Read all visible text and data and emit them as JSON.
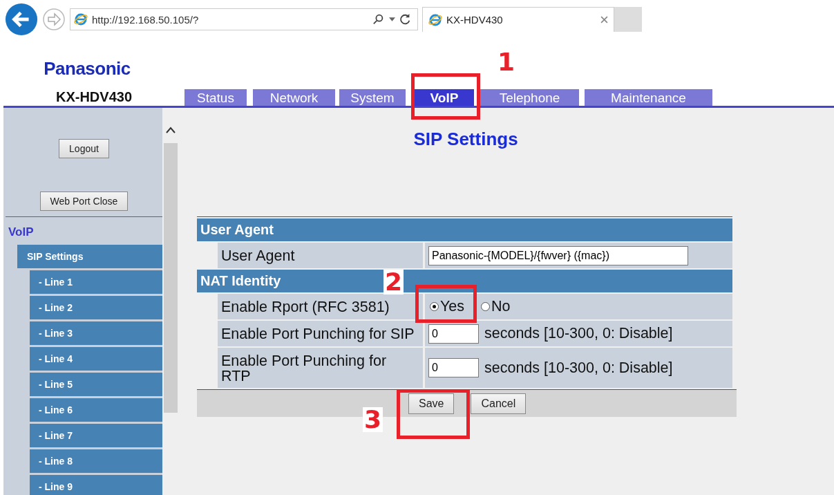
{
  "browser": {
    "url": "http://192.168.50.105/?",
    "tab_title": "KX-HDV430"
  },
  "header": {
    "logo": "Panasonic",
    "model": "KX-HDV430"
  },
  "tabs": [
    {
      "label": "Status",
      "selected": false
    },
    {
      "label": "Network",
      "selected": false
    },
    {
      "label": "System",
      "selected": false
    },
    {
      "label": "VoIP",
      "selected": true
    },
    {
      "label": "Telephone",
      "selected": false
    },
    {
      "label": "Maintenance",
      "selected": false
    }
  ],
  "sidebar": {
    "buttons": [
      "Logout",
      "Web Port Close"
    ],
    "section": "VoIP",
    "items": [
      {
        "label": "SIP Settings",
        "selected": false,
        "children": [
          {
            "label": "- Line 1",
            "selected": false
          },
          {
            "label": "- Line 2",
            "selected": false
          },
          {
            "label": "- Line 3",
            "selected": false
          },
          {
            "label": "- Line 4",
            "selected": false
          },
          {
            "label": "- Line 5",
            "selected": false
          },
          {
            "label": "- Line 6",
            "selected": false
          },
          {
            "label": "- Line 7",
            "selected": false
          },
          {
            "label": "- Line 8",
            "selected": false
          },
          {
            "label": "- Line 9",
            "selected": false
          }
        ]
      }
    ]
  },
  "page_title": "SIP Settings",
  "sections": [
    {
      "title": "User Agent",
      "rows": [
        {
          "kind": "text",
          "label": "User Agent",
          "value": "Panasonic-{MODEL}/{fwver} ({mac})"
        }
      ]
    },
    {
      "title": "NAT Identity",
      "rows": [
        {
          "kind": "radio",
          "label": "Enable Rport (RFC 3581)",
          "options": [
            {
              "label": "Yes",
              "selected": true
            },
            {
              "label": "No",
              "selected": false
            }
          ]
        },
        {
          "kind": "number",
          "label": "Enable Port Punching for SIP",
          "value": "0",
          "hint": "seconds [10-300, 0: Disable]"
        },
        {
          "kind": "number",
          "label": "Enable Port Punching for RTP",
          "value": "0",
          "hint": "seconds [10-300, 0: Disable]"
        }
      ]
    }
  ],
  "buttons": [
    "Save",
    "Cancel"
  ],
  "annotations": [
    {
      "label": "1"
    },
    {
      "label": "2"
    },
    {
      "label": "3"
    }
  ]
}
